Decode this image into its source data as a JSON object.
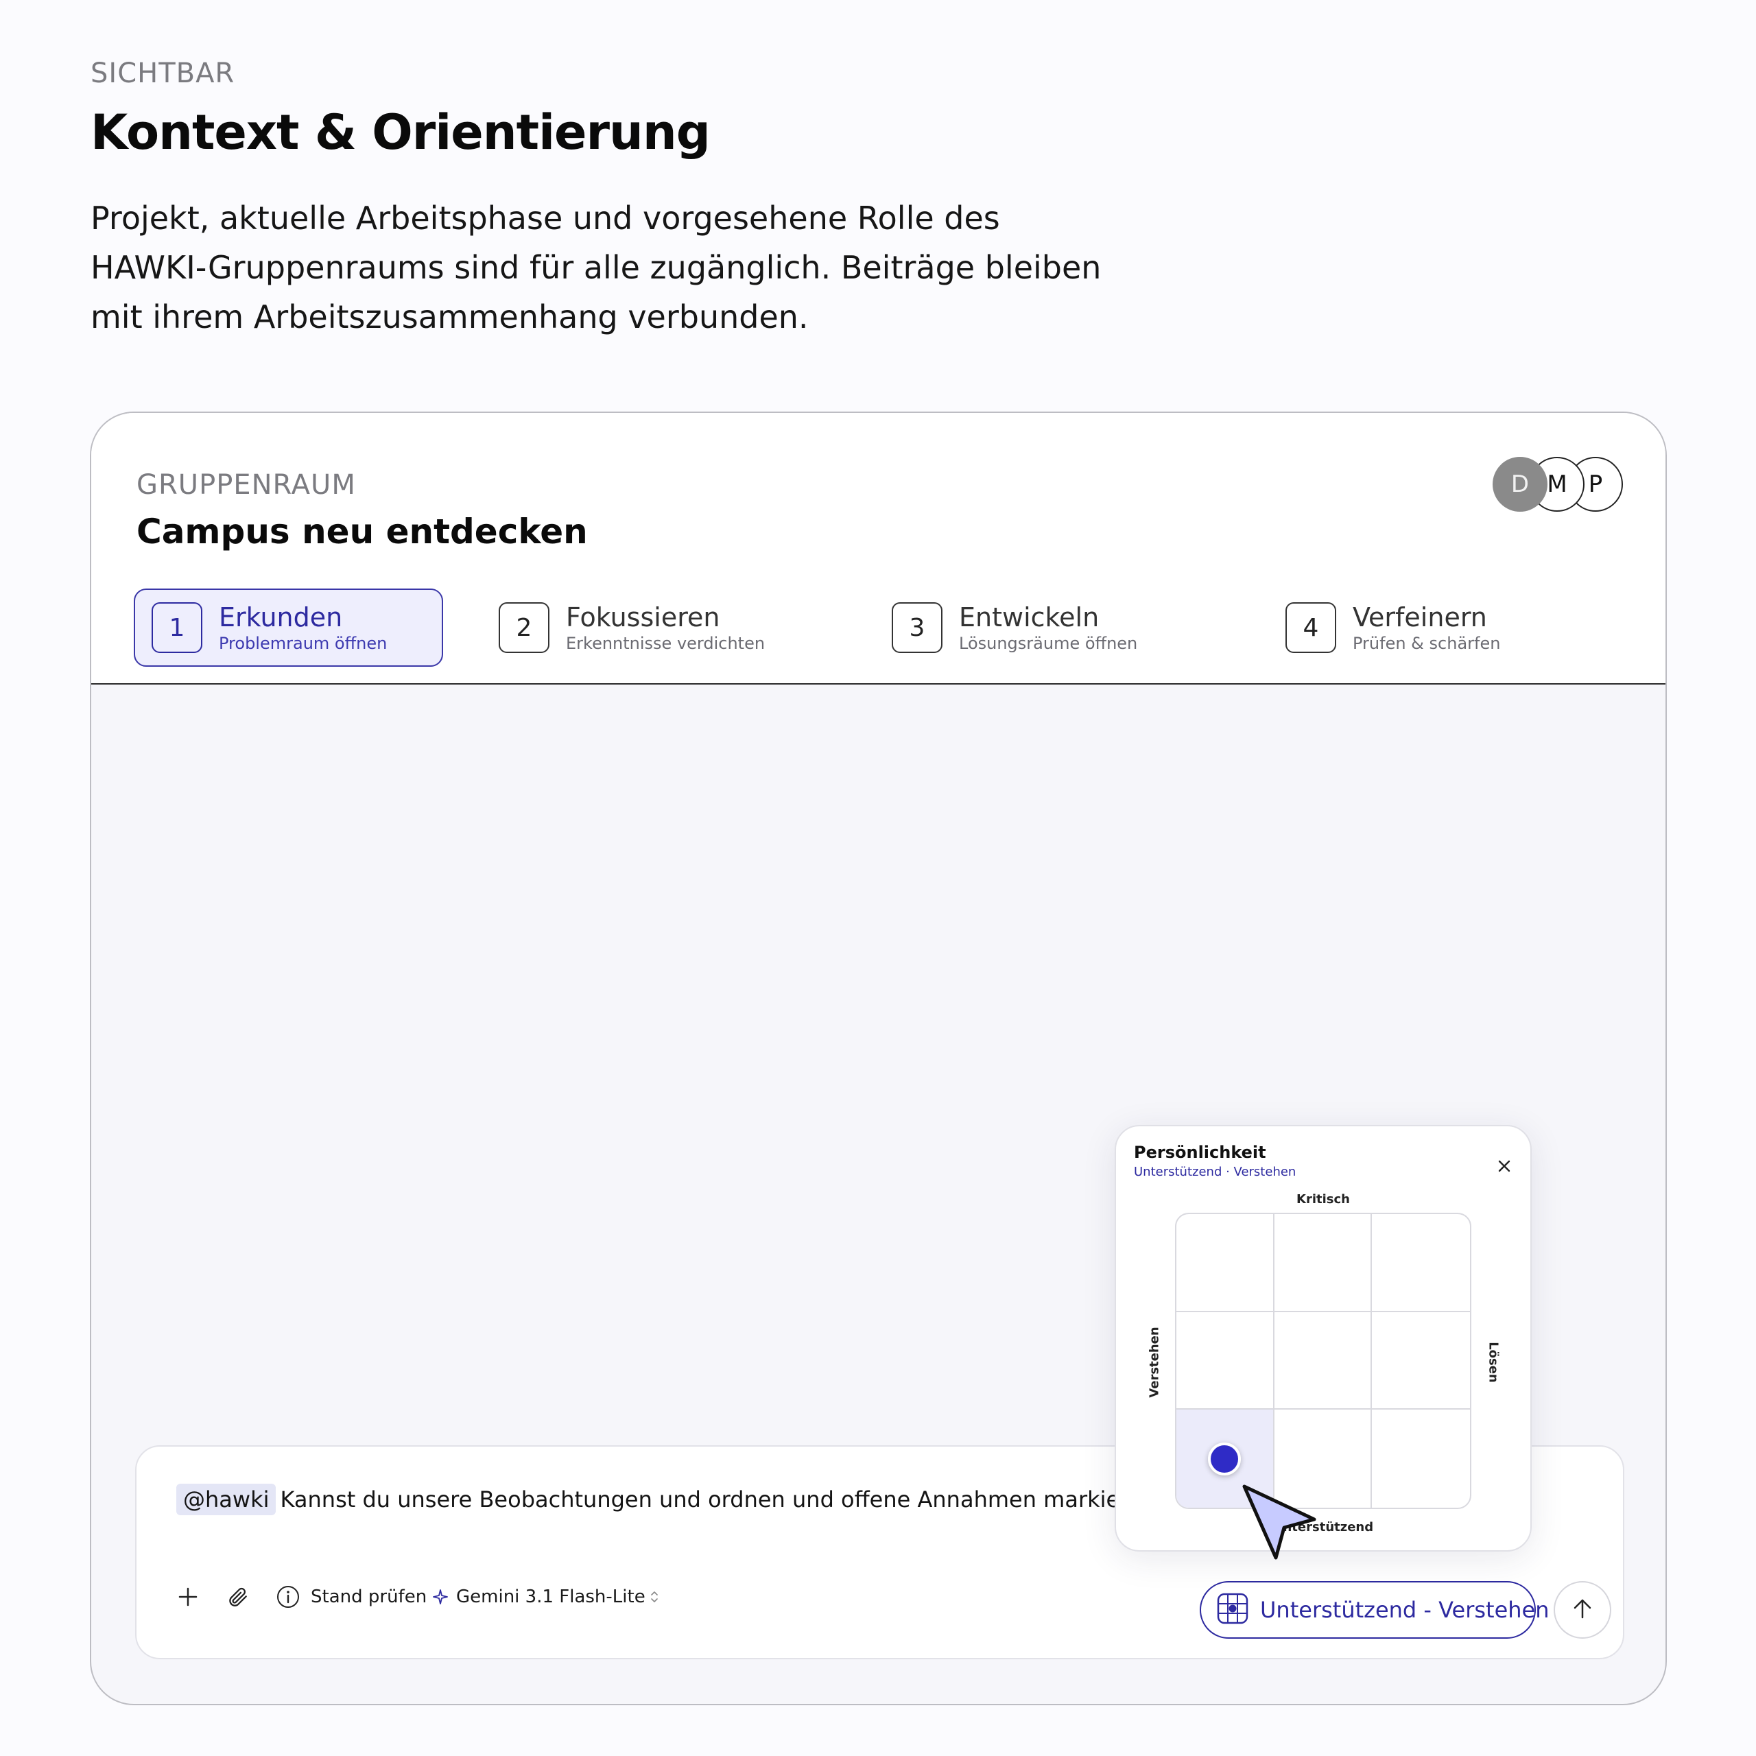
{
  "intro": {
    "eyebrow": "SICHTBAR",
    "title": "Kontext & Orientierung",
    "description": "Projekt, aktuelle Arbeitsphase und vorgesehene Rolle des HAWKI-Gruppenraums sind für alle zugänglich. Beiträge bleiben mit ihrem Arbeitszusammenhang verbunden."
  },
  "room": {
    "label": "GRUPPENRAUM",
    "title": "Campus neu entdecken",
    "members": [
      "D",
      "M",
      "P"
    ]
  },
  "phases": [
    {
      "number": "1",
      "name": "Erkunden",
      "subtitle": "Problemraum öffnen",
      "active": true
    },
    {
      "number": "2",
      "name": "Fokussieren",
      "subtitle": "Erkenntnisse verdichten",
      "active": false
    },
    {
      "number": "3",
      "name": "Entwickeln",
      "subtitle": "Lösungsräume öffnen",
      "active": false
    },
    {
      "number": "4",
      "name": "Verfeinern",
      "subtitle": "Prüfen & schärfen",
      "active": false
    }
  ],
  "composer": {
    "mention": "@hawki",
    "message": "Kannst du unsere Beobachtungen und ordnen und offene Annahmen markieren?",
    "tools": {
      "add_icon": "plus-icon",
      "attach_icon": "paperclip-icon",
      "status_label": "Stand prüfen",
      "model_label": "Gemini 3.1 Flash-Lite"
    },
    "persona_label": "Unterstützend - Verstehen",
    "send_icon": "arrow-up-icon"
  },
  "persona_picker": {
    "title": "Persönlichkeit",
    "subtitle": "Unterstützend · Verstehen",
    "axis_top": "Kritisch",
    "axis_bottom": "Unterstützend",
    "axis_left": "Verstehen",
    "axis_right": "Lösen",
    "selected_row": 2,
    "selected_col": 0
  },
  "colors": {
    "accent": "#2d2aa0",
    "accent_bg": "#eeeefd",
    "dot": "#2f2bc6",
    "canvas": "#f6f6fa"
  }
}
